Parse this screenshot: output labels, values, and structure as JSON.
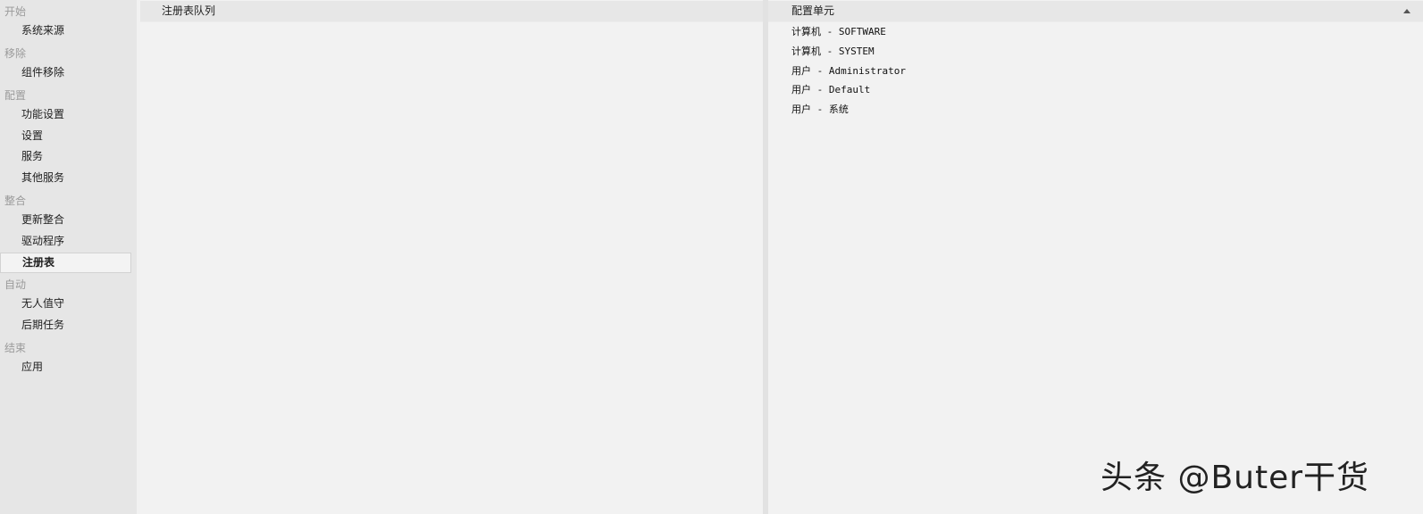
{
  "sidebar": {
    "sections": [
      {
        "label": "开始",
        "items": [
          {
            "label": "系统来源"
          }
        ]
      },
      {
        "label": "移除",
        "items": [
          {
            "label": "组件移除"
          }
        ]
      },
      {
        "label": "配置",
        "items": [
          {
            "label": "功能设置"
          },
          {
            "label": "设置"
          },
          {
            "label": "服务"
          },
          {
            "label": "其他服务"
          }
        ]
      },
      {
        "label": "整合",
        "items": [
          {
            "label": "更新整合"
          },
          {
            "label": "驱动程序"
          },
          {
            "label": "注册表",
            "selected": true
          }
        ]
      },
      {
        "label": "自动",
        "items": [
          {
            "label": "无人值守"
          },
          {
            "label": "后期任务"
          }
        ]
      },
      {
        "label": "结束",
        "items": [
          {
            "label": "应用"
          }
        ]
      }
    ]
  },
  "queue_pane": {
    "header": "注册表队列"
  },
  "hive_pane": {
    "header": "配置单元",
    "sort": "ascending",
    "rows": [
      "计算机 - SOFTWARE",
      "计算机 - SYSTEM",
      "用户 - Administrator",
      "用户 - Default",
      "用户 - 系统"
    ]
  },
  "watermark": "头条 @Buter干货"
}
